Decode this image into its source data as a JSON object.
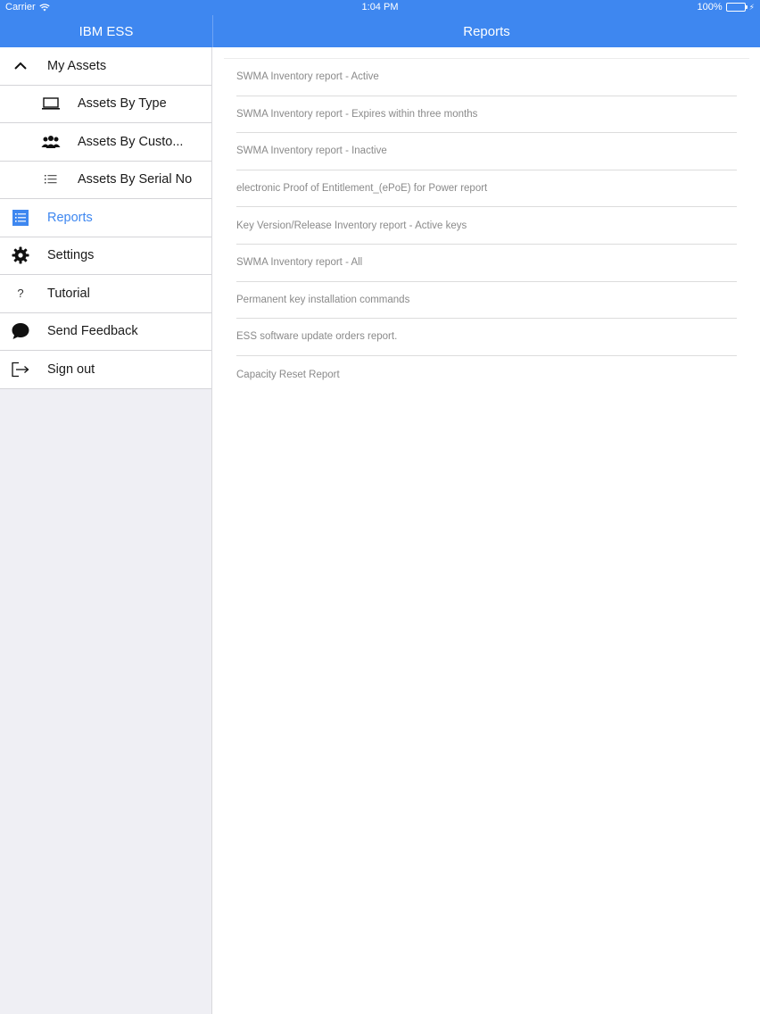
{
  "status_bar": {
    "carrier": "Carrier",
    "time": "1:04 PM",
    "battery": "100%"
  },
  "left_header": {
    "title": "IBM ESS"
  },
  "right_header": {
    "title": "Reports"
  },
  "sidebar": {
    "items": [
      {
        "label": "My Assets",
        "icon": "chevron-up-icon"
      },
      {
        "label": "Assets By Type",
        "icon": "laptop-icon"
      },
      {
        "label": "Assets By Custo...",
        "icon": "users-icon"
      },
      {
        "label": "Assets By Serial No",
        "icon": "list-icon"
      },
      {
        "label": "Reports",
        "icon": "reports-icon",
        "active": true
      },
      {
        "label": "Settings",
        "icon": "gear-icon"
      },
      {
        "label": "Tutorial",
        "icon": "question-icon"
      },
      {
        "label": "Send Feedback",
        "icon": "chat-bubble-icon"
      },
      {
        "label": "Sign out",
        "icon": "sign-out-icon"
      }
    ]
  },
  "reports": [
    "SWMA Inventory report - Active",
    "SWMA Inventory report - Expires within three months",
    "SWMA Inventory report - Inactive",
    "electronic Proof of Entitlement_(ePoE) for Power report",
    "Key Version/Release Inventory report - Active keys",
    "SWMA Inventory report - All",
    "Permanent key installation commands",
    "ESS software update orders report.",
    "Capacity Reset Report"
  ],
  "colors": {
    "accent": "#3e87f0",
    "sidebar_bg": "#efeff4",
    "report_text": "#8a8a8a"
  }
}
